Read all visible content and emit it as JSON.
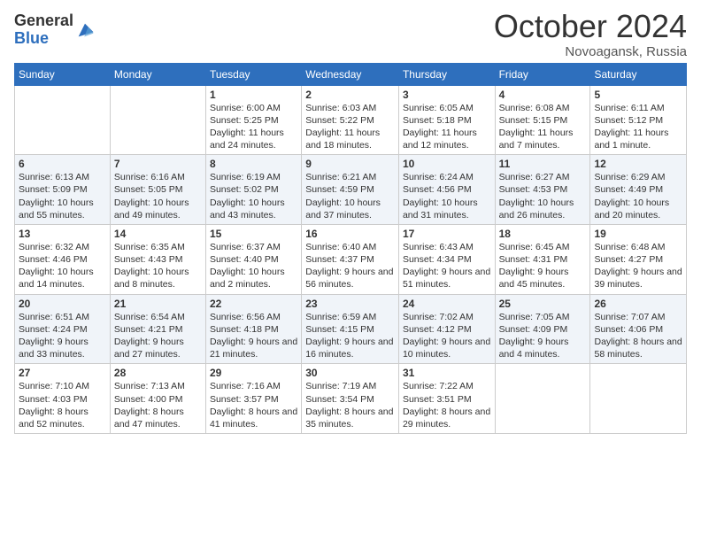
{
  "header": {
    "logo_general": "General",
    "logo_blue": "Blue",
    "month_title": "October 2024",
    "location": "Novoagansk, Russia"
  },
  "days_of_week": [
    "Sunday",
    "Monday",
    "Tuesday",
    "Wednesday",
    "Thursday",
    "Friday",
    "Saturday"
  ],
  "weeks": [
    [
      {
        "num": "",
        "info": ""
      },
      {
        "num": "",
        "info": ""
      },
      {
        "num": "1",
        "info": "Sunrise: 6:00 AM\nSunset: 5:25 PM\nDaylight: 11 hours and 24 minutes."
      },
      {
        "num": "2",
        "info": "Sunrise: 6:03 AM\nSunset: 5:22 PM\nDaylight: 11 hours and 18 minutes."
      },
      {
        "num": "3",
        "info": "Sunrise: 6:05 AM\nSunset: 5:18 PM\nDaylight: 11 hours and 12 minutes."
      },
      {
        "num": "4",
        "info": "Sunrise: 6:08 AM\nSunset: 5:15 PM\nDaylight: 11 hours and 7 minutes."
      },
      {
        "num": "5",
        "info": "Sunrise: 6:11 AM\nSunset: 5:12 PM\nDaylight: 11 hours and 1 minute."
      }
    ],
    [
      {
        "num": "6",
        "info": "Sunrise: 6:13 AM\nSunset: 5:09 PM\nDaylight: 10 hours and 55 minutes."
      },
      {
        "num": "7",
        "info": "Sunrise: 6:16 AM\nSunset: 5:05 PM\nDaylight: 10 hours and 49 minutes."
      },
      {
        "num": "8",
        "info": "Sunrise: 6:19 AM\nSunset: 5:02 PM\nDaylight: 10 hours and 43 minutes."
      },
      {
        "num": "9",
        "info": "Sunrise: 6:21 AM\nSunset: 4:59 PM\nDaylight: 10 hours and 37 minutes."
      },
      {
        "num": "10",
        "info": "Sunrise: 6:24 AM\nSunset: 4:56 PM\nDaylight: 10 hours and 31 minutes."
      },
      {
        "num": "11",
        "info": "Sunrise: 6:27 AM\nSunset: 4:53 PM\nDaylight: 10 hours and 26 minutes."
      },
      {
        "num": "12",
        "info": "Sunrise: 6:29 AM\nSunset: 4:49 PM\nDaylight: 10 hours and 20 minutes."
      }
    ],
    [
      {
        "num": "13",
        "info": "Sunrise: 6:32 AM\nSunset: 4:46 PM\nDaylight: 10 hours and 14 minutes."
      },
      {
        "num": "14",
        "info": "Sunrise: 6:35 AM\nSunset: 4:43 PM\nDaylight: 10 hours and 8 minutes."
      },
      {
        "num": "15",
        "info": "Sunrise: 6:37 AM\nSunset: 4:40 PM\nDaylight: 10 hours and 2 minutes."
      },
      {
        "num": "16",
        "info": "Sunrise: 6:40 AM\nSunset: 4:37 PM\nDaylight: 9 hours and 56 minutes."
      },
      {
        "num": "17",
        "info": "Sunrise: 6:43 AM\nSunset: 4:34 PM\nDaylight: 9 hours and 51 minutes."
      },
      {
        "num": "18",
        "info": "Sunrise: 6:45 AM\nSunset: 4:31 PM\nDaylight: 9 hours and 45 minutes."
      },
      {
        "num": "19",
        "info": "Sunrise: 6:48 AM\nSunset: 4:27 PM\nDaylight: 9 hours and 39 minutes."
      }
    ],
    [
      {
        "num": "20",
        "info": "Sunrise: 6:51 AM\nSunset: 4:24 PM\nDaylight: 9 hours and 33 minutes."
      },
      {
        "num": "21",
        "info": "Sunrise: 6:54 AM\nSunset: 4:21 PM\nDaylight: 9 hours and 27 minutes."
      },
      {
        "num": "22",
        "info": "Sunrise: 6:56 AM\nSunset: 4:18 PM\nDaylight: 9 hours and 21 minutes."
      },
      {
        "num": "23",
        "info": "Sunrise: 6:59 AM\nSunset: 4:15 PM\nDaylight: 9 hours and 16 minutes."
      },
      {
        "num": "24",
        "info": "Sunrise: 7:02 AM\nSunset: 4:12 PM\nDaylight: 9 hours and 10 minutes."
      },
      {
        "num": "25",
        "info": "Sunrise: 7:05 AM\nSunset: 4:09 PM\nDaylight: 9 hours and 4 minutes."
      },
      {
        "num": "26",
        "info": "Sunrise: 7:07 AM\nSunset: 4:06 PM\nDaylight: 8 hours and 58 minutes."
      }
    ],
    [
      {
        "num": "27",
        "info": "Sunrise: 7:10 AM\nSunset: 4:03 PM\nDaylight: 8 hours and 52 minutes."
      },
      {
        "num": "28",
        "info": "Sunrise: 7:13 AM\nSunset: 4:00 PM\nDaylight: 8 hours and 47 minutes."
      },
      {
        "num": "29",
        "info": "Sunrise: 7:16 AM\nSunset: 3:57 PM\nDaylight: 8 hours and 41 minutes."
      },
      {
        "num": "30",
        "info": "Sunrise: 7:19 AM\nSunset: 3:54 PM\nDaylight: 8 hours and 35 minutes."
      },
      {
        "num": "31",
        "info": "Sunrise: 7:22 AM\nSunset: 3:51 PM\nDaylight: 8 hours and 29 minutes."
      },
      {
        "num": "",
        "info": ""
      },
      {
        "num": "",
        "info": ""
      }
    ]
  ]
}
